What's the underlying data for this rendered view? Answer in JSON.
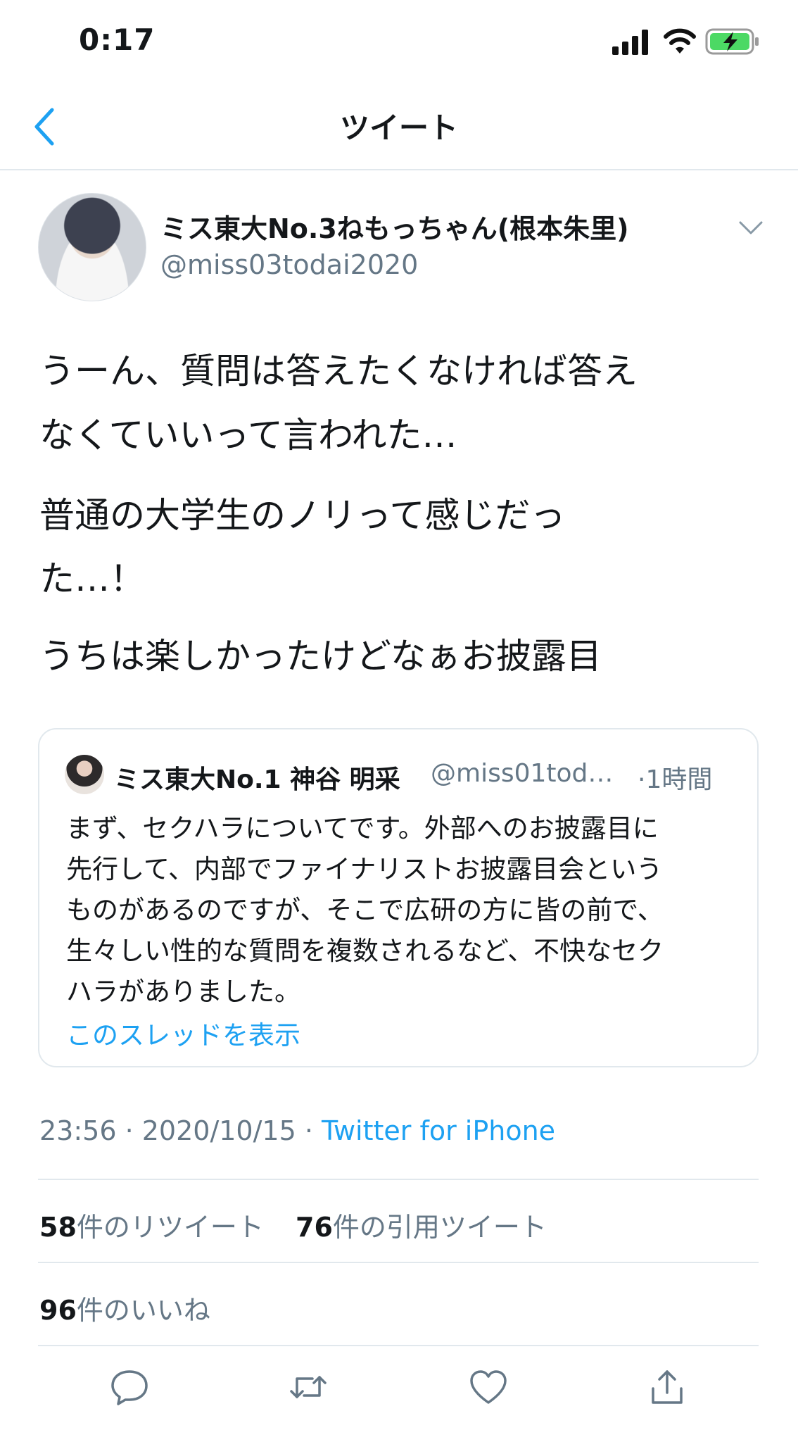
{
  "status_bar": {
    "time": "0:17",
    "signal_icon": "cellular-signal-icon",
    "wifi_icon": "wifi-icon",
    "battery_icon": "battery-charging-icon",
    "battery_color": "#4cd964"
  },
  "nav": {
    "back_icon": "chevron-left-icon",
    "title": "ツイート",
    "accent_color": "#1da1f2"
  },
  "tweet": {
    "author": {
      "name": "ミス東大No.3ねもっちゃん(根本朱里)",
      "handle": "@miss03todai2020"
    },
    "menu_icon": "chevron-down-icon",
    "body_lines": [
      "うーん、質問は答えたくなければ答え",
      "なくていいって言われた…",
      "普通の大学生のノリって感じだっ",
      "た…！",
      "うちは楽しかったけどなぁお披露目"
    ],
    "quote": {
      "name": "ミス東大No.1 神谷 明采",
      "handle": "@miss01tod…",
      "time": "·1時間",
      "lines": [
        "まず、セクハラについてです。外部へのお披露目に",
        "先行して、内部でファイナリストお披露目会という",
        "ものがあるのですが、そこで広研の方に皆の前で、",
        "生々しい性的な質問を複数されるなど、不快なセク",
        "ハラがありました。"
      ],
      "show_thread": "このスレッドを表示"
    },
    "timestamp": "23:56 · 2020/10/15 · ",
    "source": "Twitter for iPhone",
    "stats": {
      "retweets_count": "58",
      "retweets_label": "件のリツイート",
      "quotes_count": "76",
      "quotes_label": "件の引用ツイート",
      "likes_count": "96",
      "likes_label": "件のいいね"
    },
    "actions": [
      "reply-icon",
      "retweet-icon",
      "like-icon",
      "share-icon"
    ]
  }
}
